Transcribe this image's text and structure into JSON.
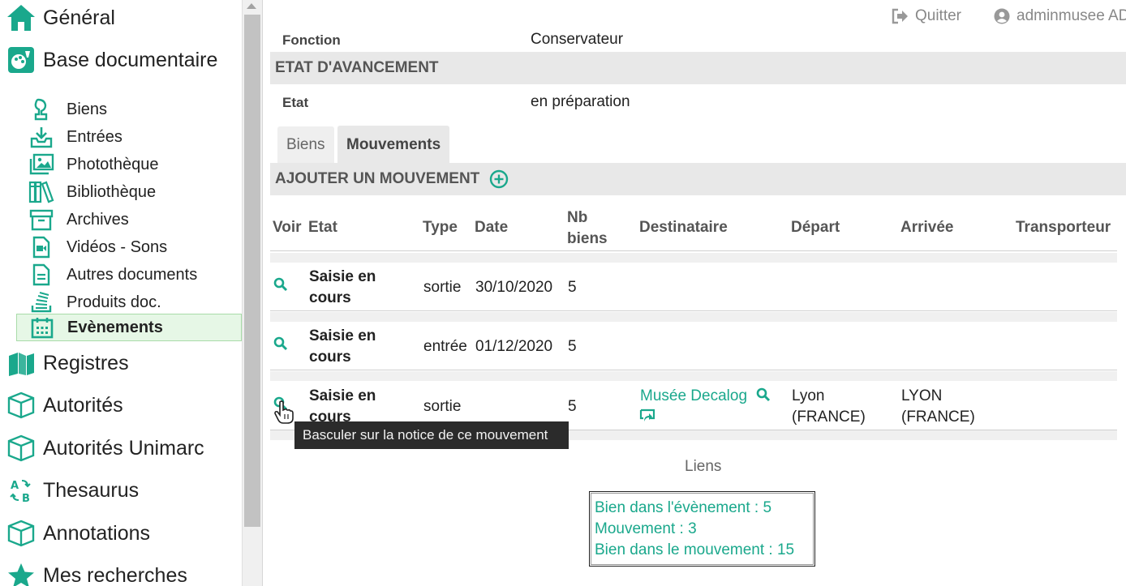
{
  "sidebar": {
    "top": {
      "general": "Général",
      "base": "Base documentaire"
    },
    "sub_items": {
      "biens": "Biens",
      "entrees": "Entrées",
      "phototheque": "Photothèque",
      "bibliotheque": "Bibliothèque",
      "archives": "Archives",
      "videos": "Vidéos - Sons",
      "autres": "Autres documents",
      "produits": "Produits doc.",
      "evenements": "Evènements"
    },
    "bottom": {
      "registres": "Registres",
      "autorites": "Autorités",
      "autorites_unimarc": "Autorités Unimarc",
      "thesaurus": "Thesaurus",
      "annotations": "Annotations",
      "recherches": "Mes recherches"
    },
    "active_item": "Evènements"
  },
  "topbar": {
    "quit_label": "Quitter",
    "user_label": "adminmusee AD"
  },
  "record": {
    "fonction_label": "Fonction",
    "fonction_value": "Conservateur",
    "section_title": "ETAT D'AVANCEMENT",
    "etat_label": "Etat",
    "etat_value": "en préparation"
  },
  "tabs": {
    "biens": "Biens",
    "mouvements": "Mouvements",
    "active": "Mouvements"
  },
  "movements": {
    "add_label": "AJOUTER UN MOUVEMENT",
    "headers": {
      "voir": "Voir",
      "etat": "Etat",
      "type": "Type",
      "date": "Date",
      "nb_line1": "Nb",
      "nb_line2": "biens",
      "destinataire": "Destinataire",
      "depart": "Départ",
      "arrivee": "Arrivée",
      "transporteur": "Transporteur"
    },
    "rows": [
      {
        "etat_line1": "Saisie en",
        "etat_line2": "cours",
        "type": "sortie",
        "date": "30/10/2020",
        "nb": "5",
        "destinataire": "",
        "depart_line1": "",
        "depart_line2": "",
        "arrivee_line1": "",
        "arrivee_line2": "",
        "transporteur": ""
      },
      {
        "etat_line1": "Saisie en",
        "etat_line2": "cours",
        "type": "entrée",
        "date": "01/12/2020",
        "nb": "5",
        "destinataire": "",
        "depart_line1": "",
        "depart_line2": "",
        "arrivee_line1": "",
        "arrivee_line2": "",
        "transporteur": ""
      },
      {
        "etat_line1": "Saisie en",
        "etat_line2": "cours",
        "type": "sortie",
        "date": "",
        "nb": "5",
        "destinataire": "Musée Decalog",
        "depart_line1": "Lyon",
        "depart_line2": "(FRANCE)",
        "arrivee_line1": "LYON",
        "arrivee_line2": "(FRANCE)",
        "transporteur": ""
      }
    ]
  },
  "tooltip": "Basculer sur la notice de ce mouvement",
  "links": {
    "title": "Liens",
    "items": [
      "Bien dans l'évènement : 5",
      "Mouvement : 3",
      "Bien dans le mouvement : 15"
    ]
  },
  "colors": {
    "accent": "#1aa88c",
    "active_bg": "#e6f7e6",
    "active_border": "#a9dca9",
    "section_bg": "#e8e8e8",
    "tooltip_bg": "#2b2b2b"
  }
}
